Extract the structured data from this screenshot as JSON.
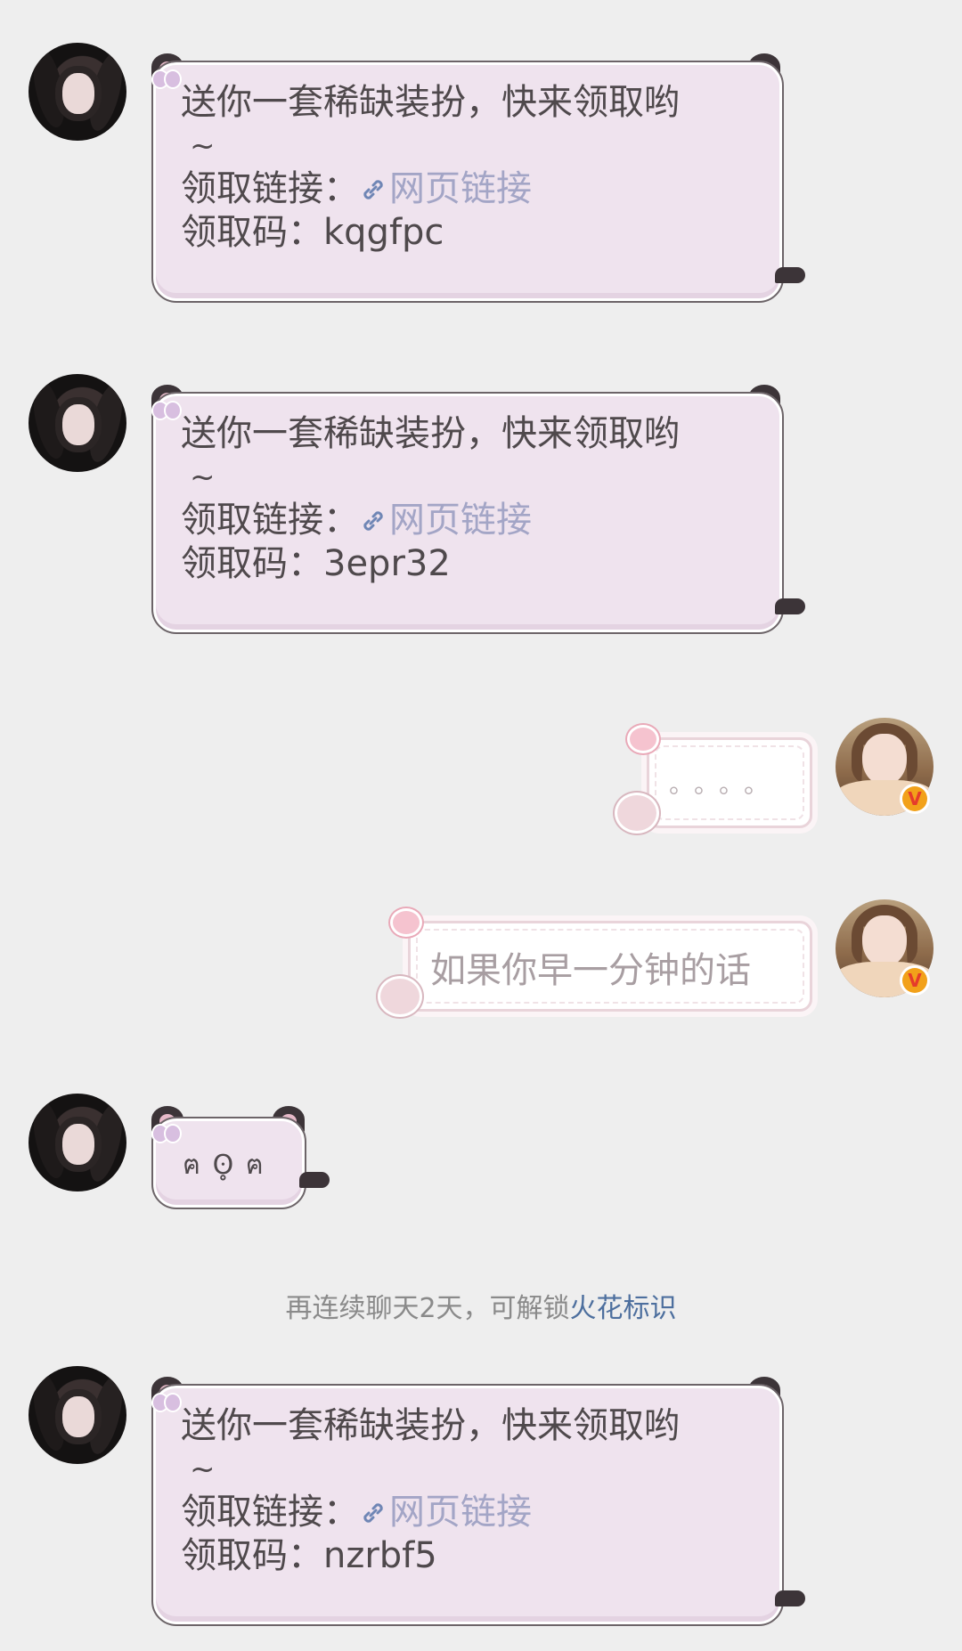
{
  "messages": [
    {
      "side": "left",
      "line1": "送你一套稀缺装扮，快来领取哟",
      "tilde": "~",
      "link_prefix": "领取链接：",
      "link_text": "网页链接",
      "code_prefix": "领取码：",
      "code": "kqgfpc"
    },
    {
      "side": "left",
      "line1": "送你一套稀缺装扮，快来领取哟",
      "tilde": "~",
      "link_prefix": "领取链接：",
      "link_text": "网页链接",
      "code_prefix": "领取码：",
      "code": "3epr32"
    },
    {
      "side": "right",
      "text": "。。。。"
    },
    {
      "side": "right",
      "text": "如果你早一分钟的话"
    },
    {
      "side": "left",
      "text": "ฅ ʘ̥ ฅ"
    },
    {
      "side": "left",
      "line1": "送你一套稀缺装扮，快来领取哟",
      "tilde": "~",
      "link_prefix": "领取链接：",
      "link_text": "网页链接",
      "code_prefix": "领取码：",
      "code": "nzrbf5"
    }
  ],
  "system_notice": {
    "prefix": "再连续聊天2天，可解锁",
    "highlight": "火花标识"
  },
  "badge": {
    "letter": "V"
  },
  "colors": {
    "background": "#eeeeee",
    "bubble_left": "#efe3ee",
    "link": "#a3a5c6",
    "notice_highlight": "#4d6f9e",
    "badge": "#f2a11a"
  },
  "icons": [
    "link-icon",
    "cat-ear",
    "bow-icon",
    "heart-sticker",
    "bear-sticker",
    "verified-badge-icon"
  ]
}
